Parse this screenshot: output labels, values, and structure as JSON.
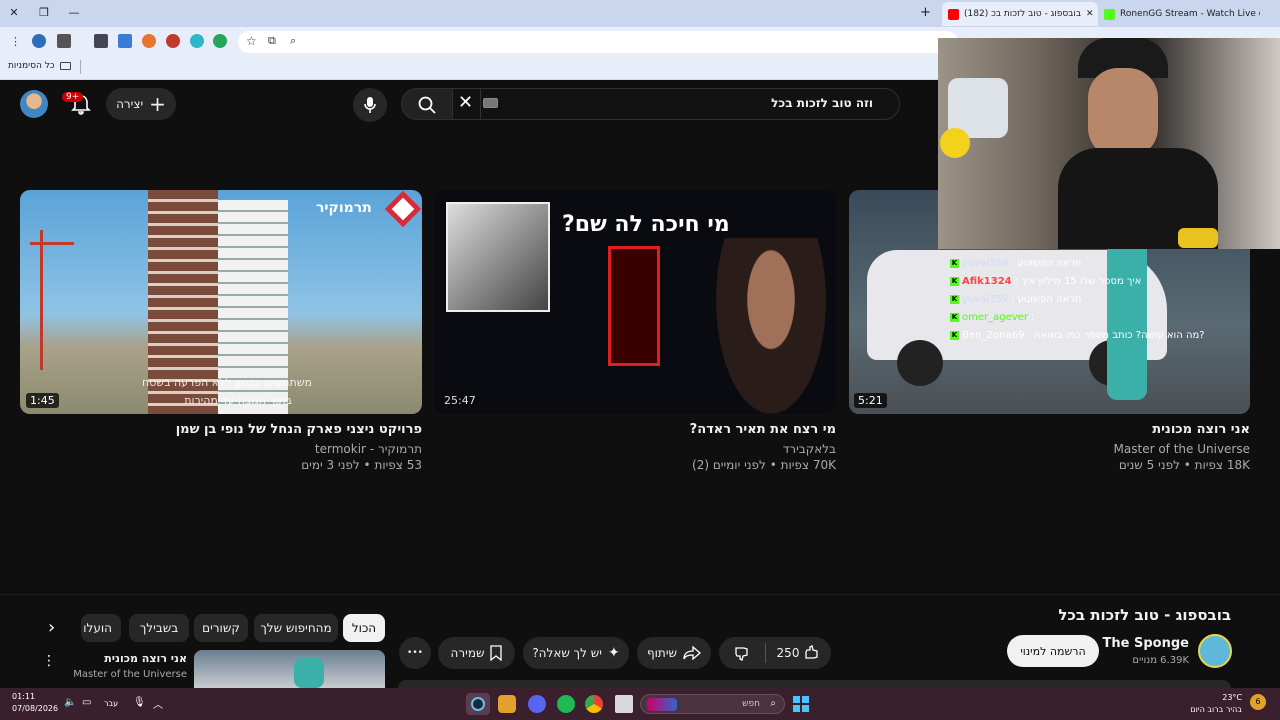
{
  "browser": {
    "tabs": [
      {
        "title": "RonenGG Stream - Watch Live o",
        "active": false
      },
      {
        "title": "(182) בובספוג - טוב לזכות בכ",
        "active": true
      },
      {
        "title": "",
        "active": false
      }
    ],
    "new_tab": "+",
    "bookmarks": {
      "all_bookmarks": "כל הסימניות"
    }
  },
  "youtube": {
    "search_query": "וזה טוב לזכות בכל",
    "create_label": "יצירה",
    "notifications": "9+",
    "videos": [
      {
        "title": "אני רוצה מכונית",
        "channel": "Master of the Universe",
        "meta": "18K צפיות • לפני 5 שנים",
        "duration": "5:21"
      },
      {
        "title": "מי רצח את תאיר ראדה?",
        "channel": "בלאקבירד",
        "meta": "70K צפיות • לפני יומיים (2)",
        "duration": "25:47",
        "thumb_text": "מי חיכה לה שם?"
      },
      {
        "title": "פרויקט ניצני פארק הנחל של נופי בן שמן",
        "channel": "תרמוקיר - termokir",
        "meta": "53 צפיות • לפני 3 ימים",
        "duration": "1:45",
        "thumb_logo": "תרמוקיר",
        "thumb_caption_1": "משתמשים בבטון ללא הפרעה בשטח",
        "thumb_caption_2": "בתוך הגובה עד מהירות"
      }
    ],
    "watch": {
      "title": "בובספוג - טוב לזכות בכל",
      "channel": "The Sponge",
      "subscribers": "6.39K מנויים",
      "subscribe": "הרשמה למינוי",
      "likes": "250",
      "share": "שיתוף",
      "ask": "יש לך שאלה?",
      "save": "שמירה",
      "more": "•••"
    },
    "chips": [
      "הכול",
      "מהחיפוש שלך",
      "קשורים",
      "בשבילך",
      "הועלו"
    ],
    "sidebar_video": {
      "title": "אני רוצה מכונית",
      "channel": "Master of the Universe"
    }
  },
  "stream_chat": [
    {
      "user": "yuval359",
      "message": "תראה הפשוטע"
    },
    {
      "user": "Afik1324",
      "message": "איך מספר שלו 15 מיליון איך"
    },
    {
      "user": "yuval359",
      "message": "תראה הפשוטע"
    },
    {
      "user": "omer_agever",
      "message": ""
    },
    {
      "user": "Ben_Zona69",
      "message": "מה הוא עושה? כותב מספר כמו בשואה?"
    }
  ],
  "taskbar": {
    "search_placeholder": "חפש",
    "time": "01:11",
    "date": "07/08/2026",
    "language": "עבר",
    "weather_temp": "23°C",
    "weather_desc": "בהיר ברוב היום",
    "weather_badge": "6"
  },
  "colors": {
    "yt_bg": "#0f0f0f",
    "tab_strip": "#c9d6ee",
    "kick_green": "#53fc18",
    "taskbar": "#3a1f2c",
    "notif_red": "#cc0000"
  }
}
